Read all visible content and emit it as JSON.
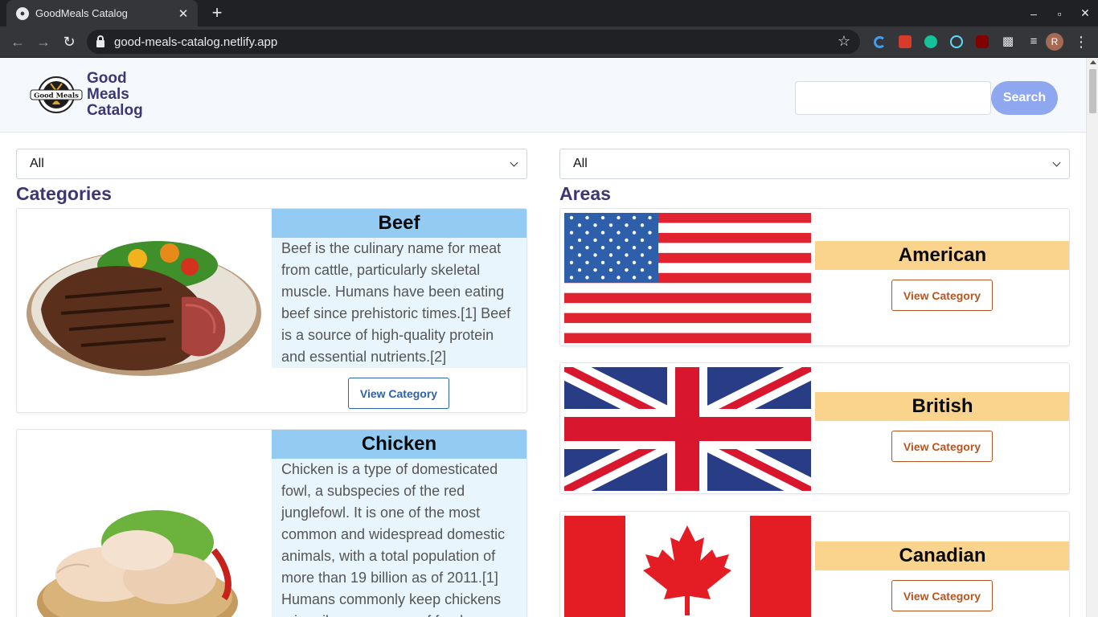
{
  "browser": {
    "tab_title": "GoodMeals Catalog",
    "url": "good-meals-catalog.netlify.app",
    "profile_initial": "R"
  },
  "header": {
    "logo_lines": [
      "Good",
      "Meals",
      "Catalog"
    ],
    "logo_badge_text": "Good Meals",
    "search_placeholder": "",
    "search_label": "Search"
  },
  "filters": {
    "category_selected": "All",
    "area_selected": "All"
  },
  "categories": {
    "title": "Categories",
    "items": [
      {
        "name": "Beef",
        "description": "Beef is the culinary name for meat from cattle, particularly skeletal muscle. Humans have been eating beef since prehistoric times.[1] Beef is a source of high-quality protein and essential nutrients.[2]",
        "button": "View Category"
      },
      {
        "name": "Chicken",
        "description": "Chicken is a type of domesticated fowl, a subspecies of the red junglefowl. It is one of the most common and widespread domestic animals, with a total population of more than 19 billion as of 2011.[1] Humans commonly keep chickens primarily as a source of food (consuming",
        "button": "View Category"
      }
    ]
  },
  "areas": {
    "title": "Areas",
    "items": [
      {
        "name": "American",
        "button": "View Category"
      },
      {
        "name": "British",
        "button": "View Category"
      },
      {
        "name": "Canadian",
        "button": "View Category"
      }
    ]
  },
  "colors": {
    "brand": "#3c3674",
    "category_header": "#93cbf3",
    "area_header": "#fad38c",
    "search_button": "#8fa7ee"
  }
}
